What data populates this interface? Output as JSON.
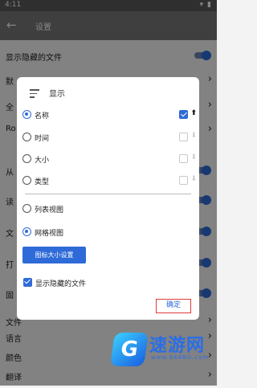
{
  "status_bar": {
    "time": "4:11",
    "icons": [
      "wifi-icon",
      "signal-icon",
      "battery-icon"
    ]
  },
  "app_bar": {
    "back_icon": "arrow-left-icon",
    "title": "设置"
  },
  "settings": {
    "rows": [
      {
        "label": "显示隐藏的文件",
        "control": "toggle"
      },
      {
        "label": "默",
        "control": "chevron"
      },
      {
        "label": "全",
        "control": "chevron"
      },
      {
        "label": "Ro",
        "control": "chevron"
      },
      {
        "label": "从",
        "control": "toggle"
      },
      {
        "label": "读",
        "control": "toggle"
      },
      {
        "label": "文",
        "control": "toggle"
      },
      {
        "label": "打",
        "control": "toggle"
      },
      {
        "label": "固",
        "control": "toggle"
      },
      {
        "label": "文件",
        "control": "chevron"
      },
      {
        "label": "语言",
        "control": "chevron"
      },
      {
        "label": "颜色",
        "control": "chevron"
      },
      {
        "label": "翻译",
        "control": "chevron"
      }
    ]
  },
  "dialog": {
    "title": "显示",
    "title_icon": "sort-icon",
    "sort_options": [
      {
        "label": "名称",
        "selected": true,
        "descending_checked": true,
        "direction_icon": "arrow-up-icon"
      },
      {
        "label": "时间",
        "selected": false,
        "descending_checked": false,
        "direction_icon": "arrow-down-icon"
      },
      {
        "label": "大小",
        "selected": false,
        "descending_checked": false,
        "direction_icon": "arrow-down-icon"
      },
      {
        "label": "类型",
        "selected": false,
        "descending_checked": false,
        "direction_icon": "arrow-down-icon"
      }
    ],
    "view_options": [
      {
        "label": "列表视图",
        "selected": false
      },
      {
        "label": "网格视图",
        "selected": true
      }
    ],
    "icon_size_button": "图标大小设置",
    "show_hidden_label": "显示隐藏的文件",
    "show_hidden_checked": true,
    "confirm_button": "确定"
  },
  "watermark": {
    "name": "速游网",
    "url": "www.868BG.com"
  },
  "colors": {
    "accent": "#2e6bd8",
    "highlight_box": "#e03a3a"
  }
}
